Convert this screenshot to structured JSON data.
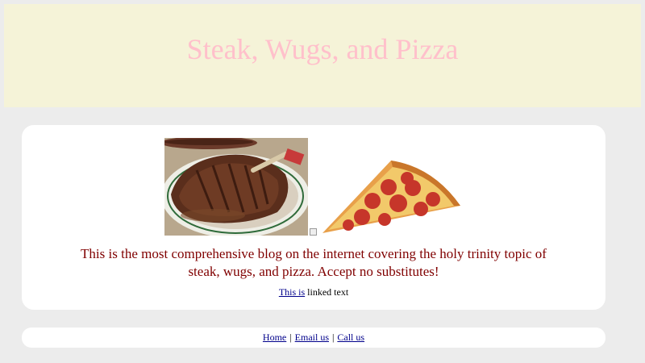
{
  "header": {
    "title": "Steak, Wugs, and Pizza"
  },
  "colors": {
    "header_background": "#f5f3d8",
    "title_color": "#ffc0cb",
    "intro_color": "#800000",
    "page_background": "#ececec"
  },
  "main": {
    "images": [
      "steak-photo",
      "broken-image-icon",
      "pizza-slice-photo"
    ],
    "intro_text": "This is the most comprehensive blog on the internet covering the holy trinity topic of steak, wugs, and pizza. Accept no substitutes!",
    "link_text": "This is",
    "link_suffix": " linked text"
  },
  "footer": {
    "links": [
      "Home",
      "Email us",
      "Call us"
    ],
    "separator": "|"
  }
}
